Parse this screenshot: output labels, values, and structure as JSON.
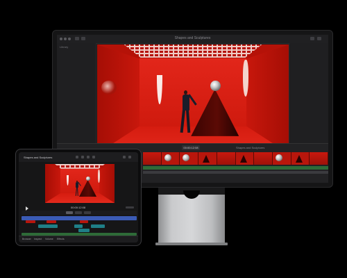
{
  "monitor": {
    "window_title": "Shapes and Sculptures",
    "library_label": "Library",
    "timecode": "00:00:12:08",
    "project_label": "Shapes and Sculptures"
  },
  "ipad": {
    "project_name": "Shapes and Sculptures",
    "timecode": "00:00:12:08",
    "bottom_bar": [
      "Browser",
      "Inspect",
      "Volume",
      "Effects"
    ]
  },
  "colors": {
    "scene_red": "#cc150a",
    "audio_green": "#2e6b38",
    "track_blue": "#3b5bb5",
    "track_teal": "#1f7f87"
  }
}
